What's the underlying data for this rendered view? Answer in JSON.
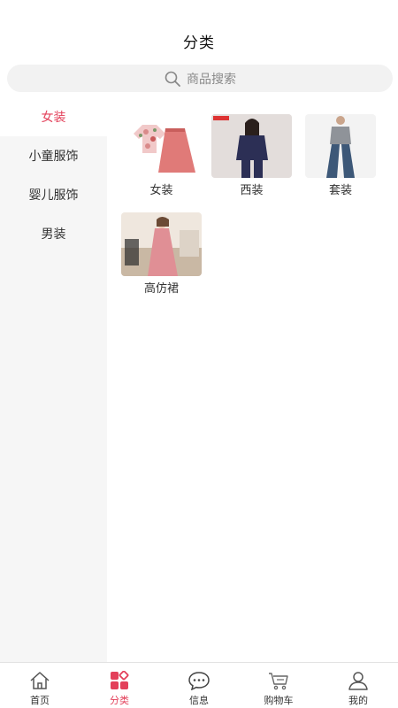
{
  "header": {
    "title": "分类"
  },
  "search": {
    "placeholder": "商品搜索"
  },
  "sidebar": {
    "items": [
      {
        "label": "女装",
        "active": true
      },
      {
        "label": "小童服饰",
        "active": false
      },
      {
        "label": "婴儿服饰",
        "active": false
      },
      {
        "label": "男装",
        "active": false
      }
    ]
  },
  "products": [
    {
      "label": "女装",
      "image": "floral-blouse-and-pink-skirt"
    },
    {
      "label": "西装",
      "image": "woman-in-navy-suit"
    },
    {
      "label": "套装",
      "image": "grey-top-and-flared-jeans"
    },
    {
      "label": "高仿裙",
      "image": "woman-in-pink-dress"
    }
  ],
  "tabbar": {
    "items": [
      {
        "label": "首页",
        "icon": "home-icon",
        "active": false
      },
      {
        "label": "分类",
        "icon": "category-icon",
        "active": true
      },
      {
        "label": "信息",
        "icon": "message-icon",
        "active": false
      },
      {
        "label": "购物车",
        "icon": "cart-icon",
        "active": false
      },
      {
        "label": "我的",
        "icon": "user-icon",
        "active": false
      }
    ]
  },
  "colors": {
    "accent": "#e3405a",
    "sidebar_bg": "#f6f6f6",
    "search_bg": "#f2f2f2"
  }
}
